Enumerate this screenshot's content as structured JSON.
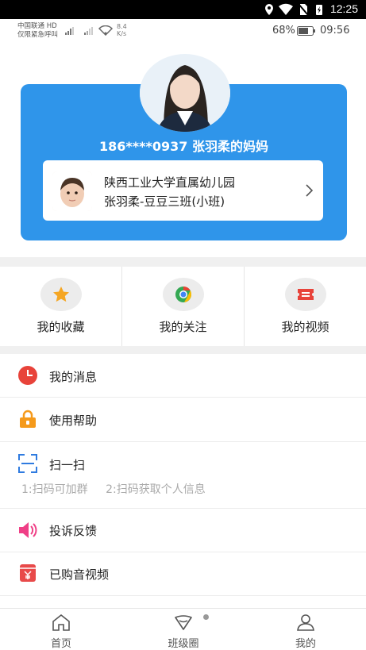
{
  "system_bar": {
    "time": "12:25"
  },
  "inner_status": {
    "carrier_line1": "中国联通 HD",
    "carrier_line2": "仅限紧急呼叫",
    "net_speed_value": "8.4",
    "net_speed_unit": "K/s",
    "battery": "68%",
    "time": "09:56"
  },
  "profile": {
    "title": "186****0937 张羽柔的妈妈",
    "school": "陕西工业大学直属幼儿园",
    "class_name": "张羽柔-豆豆三班(小班)"
  },
  "shortcuts": [
    {
      "label": "我的收藏",
      "icon": "star-icon"
    },
    {
      "label": "我的关注",
      "icon": "chrome-icon"
    },
    {
      "label": "我的视频",
      "icon": "ticket-icon"
    }
  ],
  "menu": [
    {
      "label": "我的消息",
      "icon": "clock-icon"
    },
    {
      "label": "使用帮助",
      "icon": "lock-icon"
    },
    {
      "label": "扫一扫",
      "icon": "scan-icon"
    },
    {
      "label": "投诉反馈",
      "icon": "speaker-icon"
    },
    {
      "label": "已购音视频",
      "icon": "yen-box-icon"
    }
  ],
  "scan_hints": [
    "1:扫码可加群",
    "2:扫码获取个人信息"
  ],
  "tabs": [
    {
      "label": "首页",
      "icon": "home-icon"
    },
    {
      "label": "班级圈",
      "icon": "class-circle-icon"
    },
    {
      "label": "我的",
      "icon": "user-icon"
    }
  ],
  "colors": {
    "card_blue": "#2f95ea",
    "star": "#f5a623",
    "message_red": "#e8433a",
    "help_orange": "#f59a1b",
    "scan_blue": "#2f7be0",
    "feedback_pink": "#ef3f86",
    "purchase_red": "#e84a4a"
  }
}
